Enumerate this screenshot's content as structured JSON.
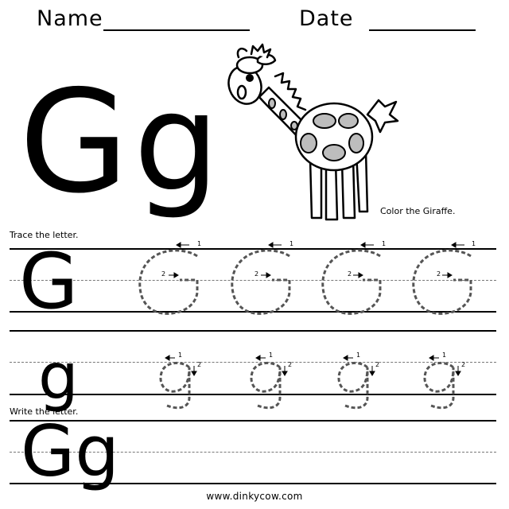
{
  "header": {
    "name_label": "Name",
    "date_label": "Date"
  },
  "hero": {
    "upper": "G",
    "lower": "g",
    "caption": "Color the Giraffe."
  },
  "trace": {
    "instruction": "Trace the letter.",
    "upper_model": "G",
    "lower_model": "g",
    "upper_trace_count": 4,
    "lower_trace_count": 4,
    "upper_stroke_numbers": [
      "1",
      "2"
    ],
    "lower_stroke_numbers": [
      "1",
      "2"
    ]
  },
  "write": {
    "instruction": "Write the letter.",
    "model": "Gg"
  },
  "footer": {
    "url": "www.dinkycow.com"
  }
}
